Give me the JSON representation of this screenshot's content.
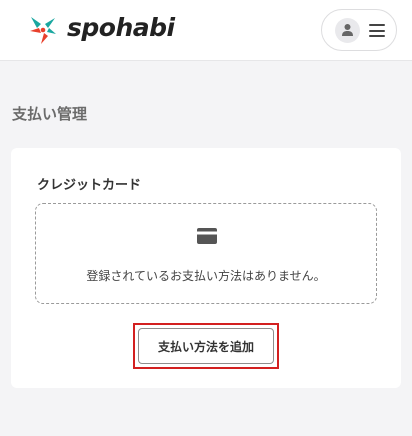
{
  "header": {
    "logo_text": "spohabi",
    "logo_icon": "pinwheel-logo",
    "user_icon": "user-icon",
    "menu_icon": "hamburger-icon"
  },
  "page": {
    "title": "支払い管理"
  },
  "credit_card_section": {
    "title": "クレジットカード",
    "empty_icon": "credit-card-icon",
    "empty_message": "登録されているお支払い方法はありません。",
    "add_button_label": "支払い方法を追加",
    "highlight_color": "#d32020"
  },
  "colors": {
    "background": "#f4f4f6",
    "card": "#ffffff",
    "logo_red": "#e8402c",
    "logo_teal": "#1aa7a0"
  }
}
